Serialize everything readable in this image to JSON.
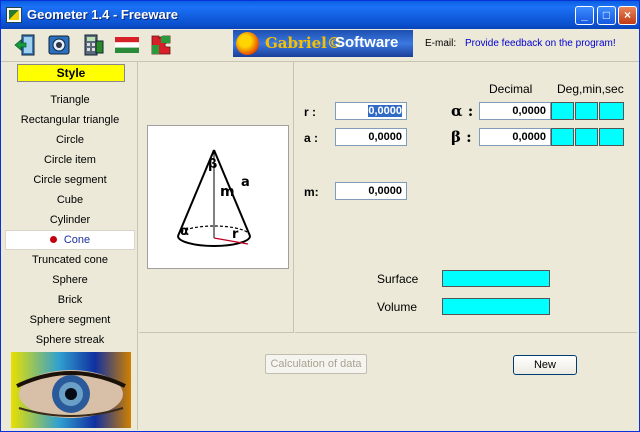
{
  "window": {
    "title": "Geometer 1.4 - Freeware"
  },
  "toolbar": {
    "icons": [
      "exit-icon",
      "camera-icon",
      "calculator-icon",
      "hungarian-flag-icon",
      "puzzle-icon"
    ],
    "logo_name": "Gabriel©",
    "logo_suffix": "Software",
    "email_label": "E-mail:",
    "feedback_link": "Provide feedback on the program!"
  },
  "sidebar": {
    "header": "Style",
    "selected_index": 7,
    "items": [
      "Triangle",
      "Rectangular triangle",
      "Circle",
      "Circle item",
      "Circle segment",
      "Cube",
      "Cylinder",
      "Cone",
      "Truncated cone",
      "Sphere",
      "Brick",
      "Sphere segment",
      "Sphere streak"
    ]
  },
  "diagram": {
    "labels": {
      "beta": "β",
      "m": "m",
      "a": "a",
      "alpha": "α",
      "r": "r"
    }
  },
  "fields": {
    "decimal_header": "Decimal",
    "dms_header": "Deg,min,sec",
    "r": {
      "label": "r :",
      "value": "0,0000"
    },
    "a": {
      "label": "a :",
      "value": "0,0000"
    },
    "m": {
      "label": "m:",
      "value": "0,0000"
    },
    "alpha": {
      "label": "α :",
      "value": "0,0000"
    },
    "beta": {
      "label": "β :",
      "value": "0,0000"
    },
    "surface_label": "Surface",
    "volume_label": "Volume"
  },
  "buttons": {
    "calculate": "Calculation of data",
    "new": "New"
  },
  "colors": {
    "style_header": "#ffff00",
    "result_fields": "#00ffff",
    "titlebar": "#0a5ee0"
  }
}
